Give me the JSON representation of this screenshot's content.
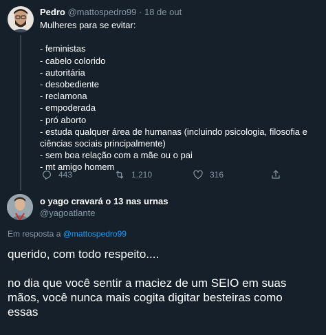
{
  "tweet1": {
    "display_name": "Pedro",
    "handle": "@mattospedro99",
    "separator": "·",
    "date": "18 de out",
    "lines": [
      "Mulheres para se evitar:",
      "",
      "- feministas",
      "- cabelo colorido",
      "- autoritária",
      "- desobediente",
      "- reclamona",
      "- empoderada",
      "- pró aborto",
      "- estuda qualquer área de humanas (incluindo psicologia, filosofia e",
      "ciências sociais principalmente)",
      "- sem boa relação com a mãe ou o pai",
      "- mt amigo homem"
    ],
    "actions": {
      "replies": "443",
      "retweets": "1.210",
      "likes": "316"
    },
    "icons": [
      "reply-icon",
      "retweet-icon",
      "like-icon",
      "share-icon"
    ]
  },
  "tweet2": {
    "display_name": "o yago cravará o 13 nas urnas",
    "handle": "@yagoatlante",
    "reply_prefix": "Em resposta a",
    "reply_handle": "@mattospedro99",
    "paragraph1": "querido, com todo respeito....",
    "paragraph2_line1": "no dia que você sentir a maciez de um SEIO em suas",
    "paragraph2_line2": "mãos, você nunca mais cogita digitar besteiras como",
    "paragraph2_line3": "essas"
  },
  "colors": {
    "background": "#15202b",
    "text": "#ffffff",
    "muted": "#8899a6",
    "link": "#1d9bf0",
    "divider": "#38444d"
  }
}
